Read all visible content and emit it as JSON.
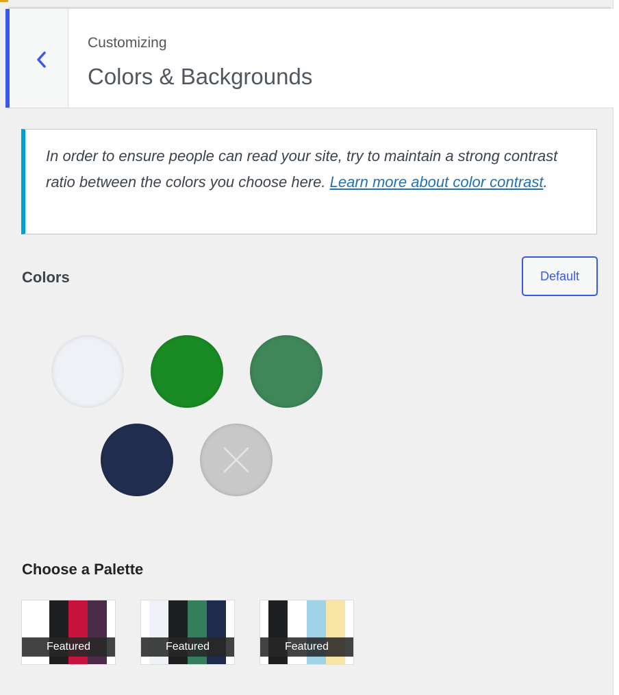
{
  "header": {
    "subtitle": "Customizing",
    "title": "Colors & Backgrounds",
    "back_icon": "chevron-left-icon"
  },
  "notice": {
    "text": "In order to ensure people can read your site, try to maintain a strong contrast ratio between the colors you choose here. ",
    "link_text": "Learn more about color contrast",
    "suffix": "."
  },
  "colors": {
    "label": "Colors",
    "default_label": "Default",
    "swatches": [
      {
        "name": "swatch-light-gray",
        "color": "#eef2f6"
      },
      {
        "name": "swatch-green",
        "color": "#1a8a24"
      },
      {
        "name": "swatch-muted-green",
        "color": "#3f8659"
      },
      {
        "name": "swatch-navy",
        "color": "#222e4f"
      },
      {
        "name": "swatch-clear",
        "color": "#c8c8c8",
        "icon": "close-icon"
      }
    ]
  },
  "palettes": {
    "label": "Choose a Palette",
    "items": [
      {
        "badge": "Featured",
        "colors": [
          "#ffffff",
          "#1e1f20",
          "#c8143c",
          "#4b2a4a"
        ]
      },
      {
        "badge": "Featured",
        "colors": [
          "#eef2f6",
          "#1e1f20",
          "#347e5b",
          "#1e2c4e"
        ]
      },
      {
        "badge": "Featured",
        "colors": [
          "#1e1f20",
          "#ffffff",
          "#9fd3e8",
          "#f8e4a4"
        ]
      }
    ]
  },
  "accent_colors": {
    "primary": "#3858e9",
    "notice_border": "#00a0d2",
    "link": "#2271b1"
  }
}
